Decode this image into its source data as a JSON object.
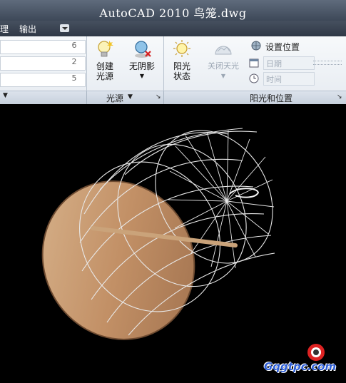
{
  "title": "AutoCAD 2010  鸟笼.dwg",
  "menu": {
    "item1": "理",
    "item2": "输出"
  },
  "ribbon": {
    "field_values": [
      "6",
      "2",
      "5"
    ],
    "create_light": "创建\n光源",
    "no_shadow": "无阴影",
    "sun_status": "阳光\n状态",
    "sky_off": "关闭天光",
    "set_location": "设置位置",
    "date": "日期",
    "time": "时间"
  },
  "panels": {
    "light": "光源",
    "sun": "阳光和位置"
  },
  "watermark": "Gqgtpc.com",
  "colors": {
    "accent": "#2e5fd8",
    "wood": "#c59a72",
    "cage": "#e8e8e8"
  }
}
